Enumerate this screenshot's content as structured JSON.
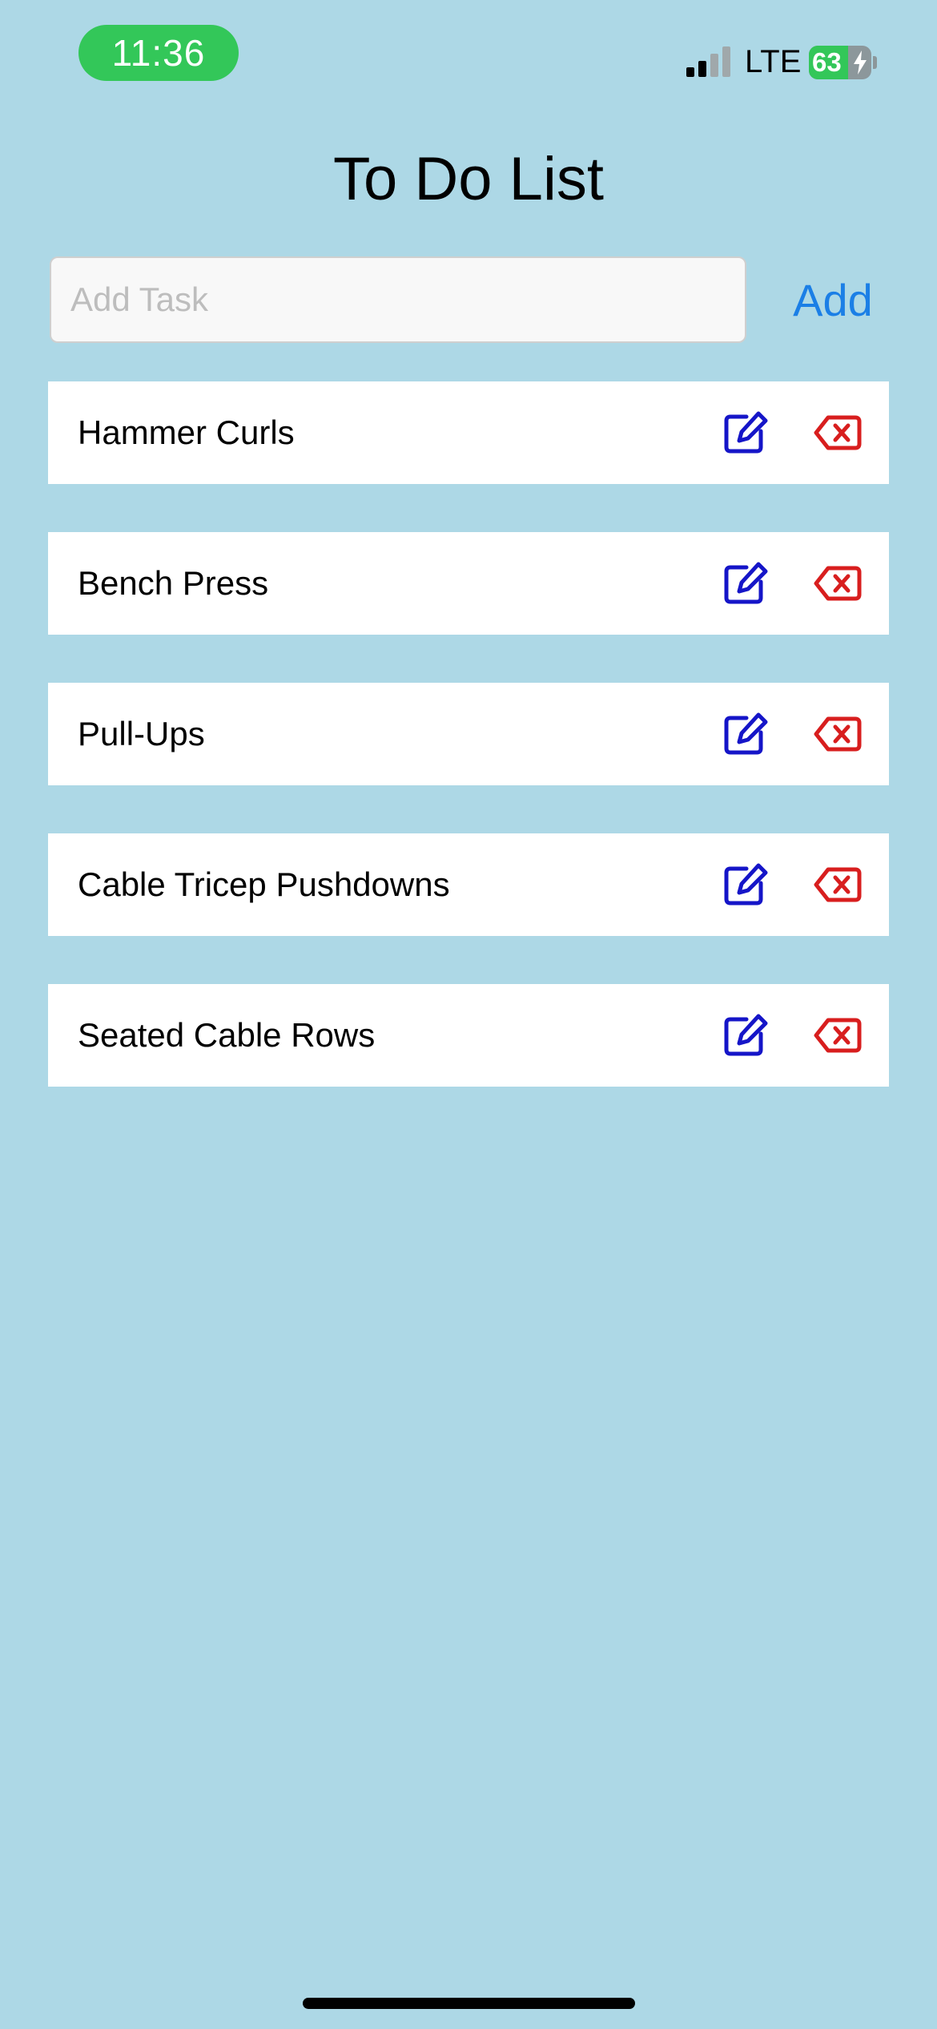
{
  "status_bar": {
    "time": "11:36",
    "carrier": "LTE",
    "battery_percent": "63",
    "battery_level": 0.63,
    "charging": true
  },
  "header": {
    "title": "To Do List"
  },
  "add_form": {
    "placeholder": "Add Task",
    "value": "",
    "button_label": "Add"
  },
  "tasks": [
    {
      "label": "Hammer Curls",
      "edit_icon": "edit-icon",
      "delete_icon": "delete-icon"
    },
    {
      "label": "Bench Press",
      "edit_icon": "edit-icon",
      "delete_icon": "delete-icon"
    },
    {
      "label": "Pull-Ups",
      "edit_icon": "edit-icon",
      "delete_icon": "delete-icon"
    },
    {
      "label": "Cable Tricep Pushdowns",
      "edit_icon": "edit-icon",
      "delete_icon": "delete-icon"
    },
    {
      "label": "Seated Cable Rows",
      "edit_icon": "edit-icon",
      "delete_icon": "delete-icon"
    }
  ],
  "colors": {
    "background": "#add8e6",
    "accent": "#1b7fe6",
    "edit_icon": "#1515c8",
    "delete_icon": "#d81e1e",
    "time_pill": "#33c759"
  }
}
